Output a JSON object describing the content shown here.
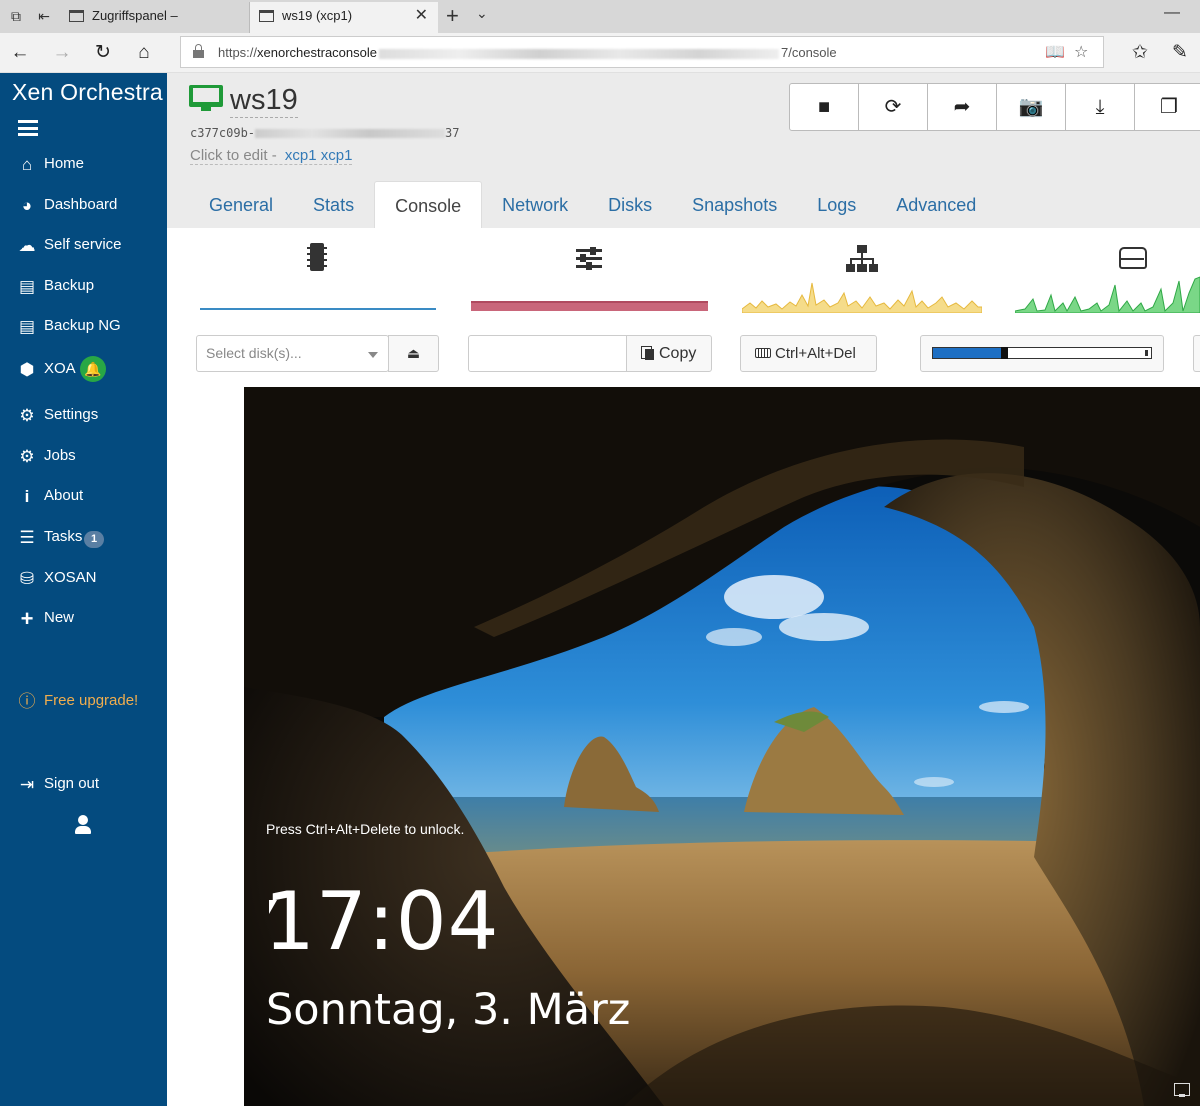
{
  "browser": {
    "tabs": [
      {
        "title": "Zugriffspanel – Anwendung",
        "active": false
      },
      {
        "title": "ws19 (xcp1)",
        "active": true
      }
    ],
    "url_prefix": "https://",
    "url_host": "xenorchestraconsole",
    "url_suffix": "7/console"
  },
  "sidebar": {
    "brand": "Xen Orchestra",
    "items": [
      {
        "label": "Home",
        "icon": "home-icon"
      },
      {
        "label": "Dashboard",
        "icon": "dashboard-icon"
      },
      {
        "label": "Self service",
        "icon": "cloud-icon"
      },
      {
        "label": "Backup",
        "icon": "archive-icon"
      },
      {
        "label": "Backup NG",
        "icon": "archive-icon"
      },
      {
        "label": "XOA",
        "icon": "cube-icon"
      },
      {
        "label": "Settings",
        "icon": "gear-icon"
      },
      {
        "label": "Jobs",
        "icon": "gears-icon"
      },
      {
        "label": "About",
        "icon": "info-icon"
      },
      {
        "label": "Tasks",
        "icon": "tasks-icon",
        "badge": "1"
      },
      {
        "label": "XOSAN",
        "icon": "database-icon"
      },
      {
        "label": "New",
        "icon": "plus-icon"
      }
    ],
    "upgrade": "Free upgrade!",
    "sign_out": "Sign out"
  },
  "vm": {
    "name": "ws19",
    "uuid_start": "c377c09b-",
    "uuid_end": "37",
    "description": "Click to edit",
    "separator": " - ",
    "pool": "xcp1 xcp1"
  },
  "tabs": [
    "General",
    "Stats",
    "Console",
    "Network",
    "Disks",
    "Snapshots",
    "Logs",
    "Advanced"
  ],
  "active_tab": "Console",
  "console_toolbar": {
    "disk_placeholder": "Select disk(s)...",
    "copy_label": "Copy",
    "cad_label": "Ctrl+Alt+Del",
    "scale_value": 0.31
  },
  "console": {
    "hint": "Press Ctrl+Alt+Delete to unlock.",
    "time": "17:04",
    "date": "Sonntag, 3. März"
  },
  "colors": {
    "sidebar": "#044b7f",
    "link": "#2b6ea5",
    "vm_running": "#1f9a38",
    "memory": "#c9667a",
    "cpu": "#3a8bc4",
    "network": "#f2d27a",
    "disk": "#5cc46e"
  }
}
